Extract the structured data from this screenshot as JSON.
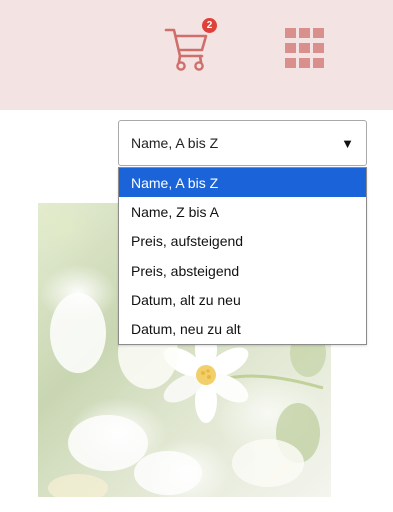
{
  "header": {
    "cart": {
      "badge_count": "2",
      "icon": "shopping-cart-icon",
      "badge_color": "#e0403a",
      "icon_color": "#cf6f6c"
    },
    "grid_view": {
      "icon": "grid-icon",
      "color": "#d9908d"
    }
  },
  "sort": {
    "selected_label": "Name, A bis Z",
    "caret_glyph": "▼",
    "options": [
      "Name, A bis Z",
      "Name, Z bis A",
      "Preis, aufsteigend",
      "Preis, absteigend",
      "Datum, alt zu neu",
      "Datum, neu zu alt"
    ],
    "highlight_color": "#1a63d8"
  },
  "product": {
    "image_icon": "flower-photo-icon"
  }
}
